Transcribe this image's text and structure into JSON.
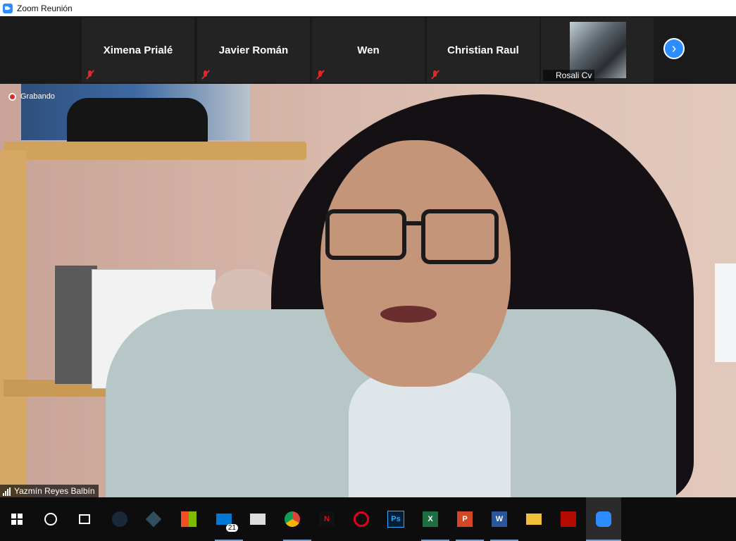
{
  "window": {
    "title": "Zoom Reunión"
  },
  "participants": [
    {
      "name": "Ximena Prialé"
    },
    {
      "name": "Javier Román"
    },
    {
      "name": "Wen"
    },
    {
      "name": "Christian Raul"
    },
    {
      "name": "Rosali Cv"
    }
  ],
  "main_video": {
    "recording_label": "Grabando",
    "speaker_name": "Yazmín Reyes Balbín"
  },
  "taskbar": {
    "mail_badge": "21",
    "photoshop_label": "Ps",
    "excel_label": "X",
    "powerpoint_label": "P",
    "word_label": "W"
  },
  "colors": {
    "zoom_blue": "#2d8cff",
    "mute_red": "#e02828",
    "strip_bg": "#1a1a1a",
    "taskbar_bg": "#0d0d0d"
  },
  "icons": [
    "zoom-app-icon",
    "muted-mic-icon",
    "next-page-icon",
    "record-icon",
    "signal-icon",
    "windows-start-icon",
    "search-icon",
    "task-view-icon",
    "steam-icon",
    "app-icon",
    "store-icon",
    "mail-icon",
    "clapper-icon",
    "chrome-icon",
    "netflix-icon",
    "opera-icon",
    "photoshop-icon",
    "excel-icon",
    "powerpoint-icon",
    "word-icon",
    "file-explorer-icon",
    "acrobat-icon",
    "zoom-taskbar-icon"
  ]
}
